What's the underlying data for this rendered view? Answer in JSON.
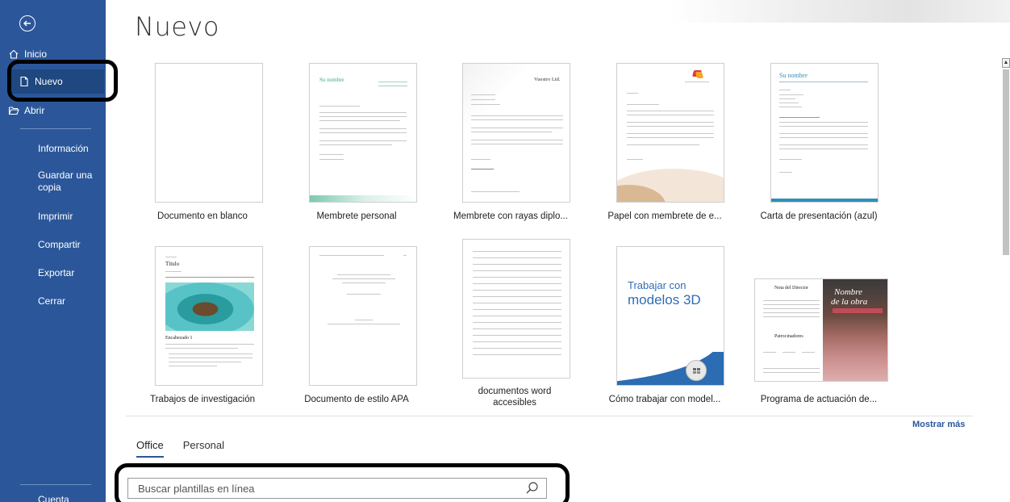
{
  "sidebar": {
    "back_icon": "back-arrow-icon",
    "items": [
      {
        "label": "Inicio",
        "icon": "home-icon"
      },
      {
        "label": "Nuevo",
        "icon": "new-document-icon"
      },
      {
        "label": "Abrir",
        "icon": "folder-open-icon"
      },
      {
        "label": "Información"
      },
      {
        "label": "Guardar una copia"
      },
      {
        "label": "Imprimir"
      },
      {
        "label": "Compartir"
      },
      {
        "label": "Exportar"
      },
      {
        "label": "Cerrar"
      }
    ],
    "bottom_partial": "Cuenta"
  },
  "main": {
    "title": "Nuevo",
    "templates": [
      {
        "label": "Documento en blanco"
      },
      {
        "label": "Membrete personal",
        "name_text": "Su nombre"
      },
      {
        "label": "Membrete con rayas diplo...",
        "name_text": "Vuestro Ltd."
      },
      {
        "label": "Papel con membrete de e..."
      },
      {
        "label": "Carta de presentación (azul)",
        "name_text": "Su nombre"
      },
      {
        "label": "Trabajos de investigación",
        "heading_text": "Título",
        "section_text": "Encabezado 1"
      },
      {
        "label": "Documento de estilo APA"
      },
      {
        "label": "documentos word accesibles"
      },
      {
        "label": "Cómo trabajar con model...",
        "cover_text_1": "Trabajar con",
        "cover_text_2": "modelos 3D"
      },
      {
        "label": "Programa de actuación de...",
        "poster_title_1": "Nombre",
        "poster_title_2": "de la obra",
        "poster_left": "Nota del Director",
        "poster_sponsors": "Patrocinadores"
      }
    ],
    "more_link": "Mostrar más",
    "tabs": [
      {
        "label": "Office",
        "active": true
      },
      {
        "label": "Personal",
        "active": false
      }
    ],
    "search": {
      "placeholder": "Buscar plantillas en línea",
      "icon": "search-icon"
    }
  },
  "colors": {
    "sidebar_bg": "#2b579a",
    "sidebar_selected": "#1f4780",
    "accent": "#2b579a",
    "annotation": "#000000"
  }
}
